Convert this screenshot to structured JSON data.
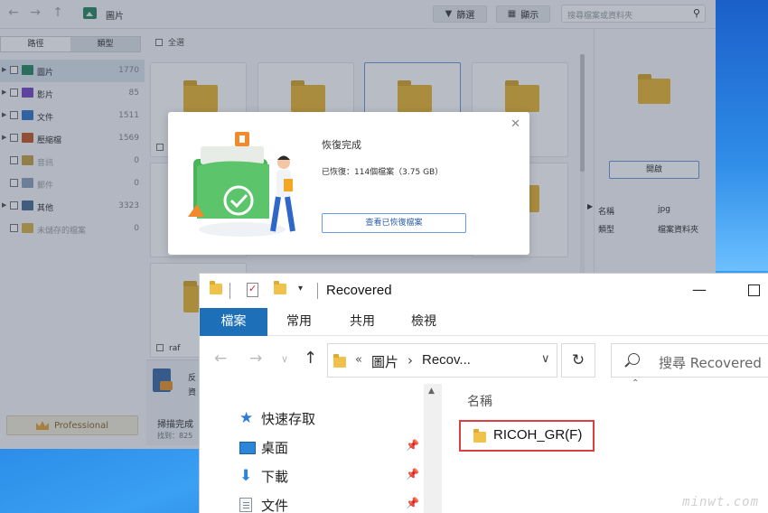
{
  "app": {
    "title": "圖片",
    "filter_label": "篩選",
    "display_label": "顯示",
    "search_placeholder": "搜尋檔案或資料夾",
    "tabs": [
      "路徑",
      "類型"
    ],
    "select_all": "全選",
    "tree": [
      {
        "label": "圖片",
        "count": "1770",
        "color": "#2d8a66",
        "selected": true,
        "expandable": true,
        "muted": false
      },
      {
        "label": "影片",
        "count": "85",
        "color": "#7a4bc2",
        "selected": false,
        "expandable": true,
        "muted": false
      },
      {
        "label": "文件",
        "count": "1511",
        "color": "#3a78c9",
        "selected": false,
        "expandable": true,
        "muted": false
      },
      {
        "label": "壓縮檔",
        "count": "1569",
        "color": "#c65a2c",
        "selected": false,
        "expandable": true,
        "muted": false
      },
      {
        "label": "音訊",
        "count": "0",
        "color": "#c7a24a",
        "selected": false,
        "expandable": false,
        "muted": true
      },
      {
        "label": "郵件",
        "count": "0",
        "color": "#8fa3bb",
        "selected": false,
        "expandable": false,
        "muted": true
      },
      {
        "label": "其他",
        "count": "3323",
        "color": "#4d6f96",
        "selected": false,
        "expandable": true,
        "muted": false
      },
      {
        "label": "未儲存的檔案",
        "count": "0",
        "color": "#d9b54b",
        "selected": false,
        "expandable": false,
        "muted": true
      }
    ],
    "folder_label": "raf",
    "professional_label": "Professional",
    "scan_line1": "反",
    "scan_line2": "資",
    "scan_done": "掃描完成",
    "scan_found": "找到：825",
    "preview": {
      "open_label": "開啟",
      "meta": [
        {
          "key": "名稱",
          "value": "jpg"
        },
        {
          "key": "類型",
          "value": "檔案資料夾"
        }
      ]
    }
  },
  "dialog": {
    "title": "恢復完成",
    "subtitle": "已恢復：114個檔案（3.75 GB）",
    "view_button": "查看已恢復檔案"
  },
  "explorer": {
    "title": "Recovered",
    "ribbon_tabs": [
      "檔案",
      "常用",
      "共用",
      "檢視"
    ],
    "address_prefix": "«",
    "breadcrumb": [
      "圖片",
      "Recov..."
    ],
    "search_placeholder": "搜尋 Recovered",
    "nav_items": [
      "快速存取",
      "桌面",
      "下載",
      "文件"
    ],
    "column_name": "名稱",
    "item": "RICOH_GR(F)"
  },
  "watermark": "minwt.com",
  "colors": {
    "accent": "#1d6fb8",
    "folder": "#f0c14b",
    "highlight_box": "#d94141",
    "dialog_check": "#5cc46a"
  }
}
